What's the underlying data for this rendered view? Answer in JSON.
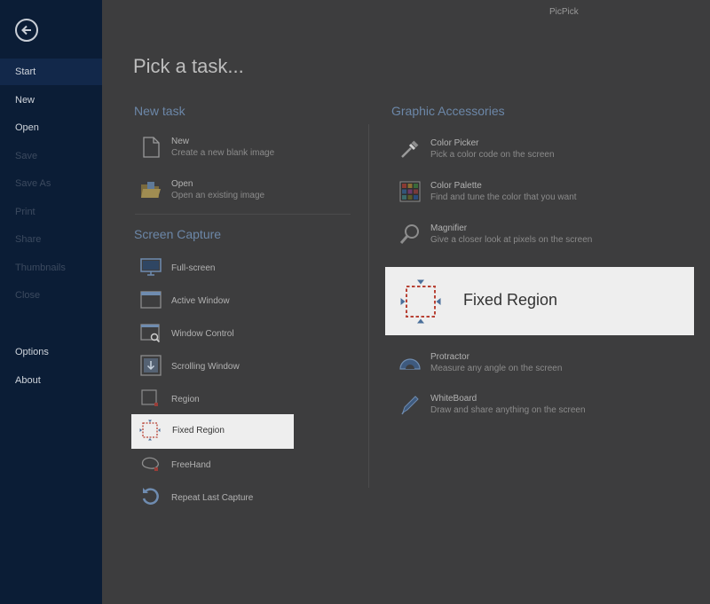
{
  "app_title": "PicPick",
  "sidebar": {
    "items": [
      {
        "label": "Start",
        "state": "active"
      },
      {
        "label": "New",
        "state": "normal"
      },
      {
        "label": "Open",
        "state": "normal"
      },
      {
        "label": "Save",
        "state": "disabled"
      },
      {
        "label": "Save As",
        "state": "disabled"
      },
      {
        "label": "Print",
        "state": "disabled"
      },
      {
        "label": "Share",
        "state": "disabled"
      },
      {
        "label": "Thumbnails",
        "state": "disabled"
      },
      {
        "label": "Close",
        "state": "disabled"
      },
      {
        "label": "Options",
        "state": "normal"
      },
      {
        "label": "About",
        "state": "normal"
      }
    ]
  },
  "main": {
    "title": "Pick a task...",
    "new_task": {
      "heading": "New task",
      "items": [
        {
          "label": "New",
          "description": "Create a new blank image",
          "icon": "new-document-icon"
        },
        {
          "label": "Open",
          "description": "Open an existing image",
          "icon": "folder-open-icon"
        }
      ]
    },
    "screen_capture": {
      "heading": "Screen Capture",
      "items": [
        {
          "label": "Full-screen",
          "icon": "monitor-icon"
        },
        {
          "label": "Active Window",
          "icon": "window-icon"
        },
        {
          "label": "Window Control",
          "icon": "window-control-icon"
        },
        {
          "label": "Scrolling Window",
          "icon": "scrolling-window-icon"
        },
        {
          "label": "Region",
          "icon": "region-icon"
        },
        {
          "label": "Fixed Region",
          "icon": "fixed-region-icon"
        },
        {
          "label": "FreeHand",
          "icon": "freehand-icon"
        },
        {
          "label": "Repeat Last Capture",
          "icon": "repeat-icon"
        }
      ]
    },
    "graphic_accessories": {
      "heading": "Graphic Accessories",
      "items": [
        {
          "label": "Color Picker",
          "description": "Pick a color code on the screen",
          "icon": "eyedropper-icon"
        },
        {
          "label": "Color Palette",
          "description": "Find and tune the color that you want",
          "icon": "palette-icon"
        },
        {
          "label": "Magnifier",
          "description": "Give a closer look at pixels on the screen",
          "icon": "magnifier-icon"
        },
        {
          "label": "Protractor",
          "description": "Measure any angle on the screen",
          "icon": "protractor-icon"
        },
        {
          "label": "WhiteBoard",
          "description": "Draw and share anything on the screen",
          "icon": "pen-icon"
        }
      ]
    },
    "highlight_small": {
      "label": "Fixed Region"
    },
    "highlight_big": {
      "label": "Fixed Region"
    }
  }
}
